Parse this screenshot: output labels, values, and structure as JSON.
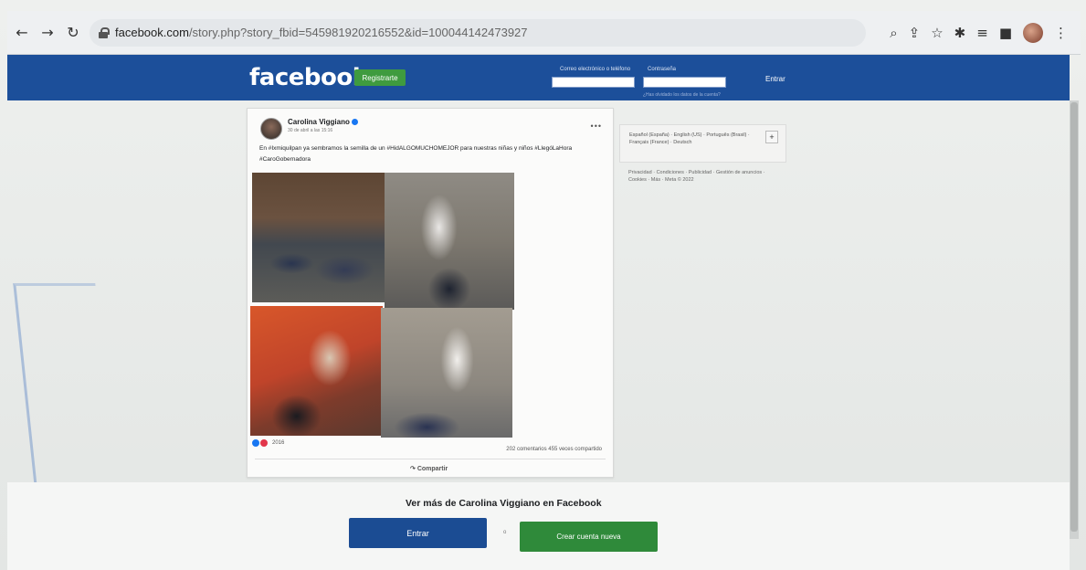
{
  "browser": {
    "url_host": "facebook.com",
    "url_rest": "/story.php?story_fbid=545981920216552&id=100044142473927",
    "icons": [
      "back-icon",
      "forward-icon",
      "reload-icon",
      "lock-icon",
      "zoom-icon",
      "share-icon",
      "star-icon",
      "extension-icon",
      "reading-list-icon",
      "tab-icon",
      "profile-avatar",
      "menu-icon"
    ]
  },
  "header": {
    "logo": "facebook",
    "register_label": "Registrarte",
    "email_label": "Correo electrónico o teléfono",
    "password_label": "Contraseña",
    "forgot_link": "¿Has olvidado los datos de la cuenta?",
    "login_label": "Entrar",
    "brand_color": "#1c4f9a",
    "register_color": "#3f9b3f"
  },
  "post": {
    "author": "Carolina Viggiano",
    "date": "30 de abril a las 15:16",
    "text": "En #Ixmiquilpan ya sembramos la semilla de un #HidALGOMUCHOMEJOR para nuestras niñas y niños #LlegóLaHora #CaroGobernadora",
    "reaction_count": "2016",
    "stats": "202 comentarios  455 veces compartido",
    "share_action": "Compartir"
  },
  "sidebar": {
    "languages": "Español (España) · English (US) · Português (Brasil) · Français (France) · Deutsch",
    "plus_label": "+",
    "footer": "Privacidad · Condiciones · Publicidad · Gestión de anuncios · Cookies · Más · Meta © 2022"
  },
  "bottom": {
    "see_more": "Ver más de Carolina Viggiano en Facebook",
    "enter_label": "Entrar",
    "or_label": "o",
    "create_label": "Crear cuenta nueva"
  }
}
